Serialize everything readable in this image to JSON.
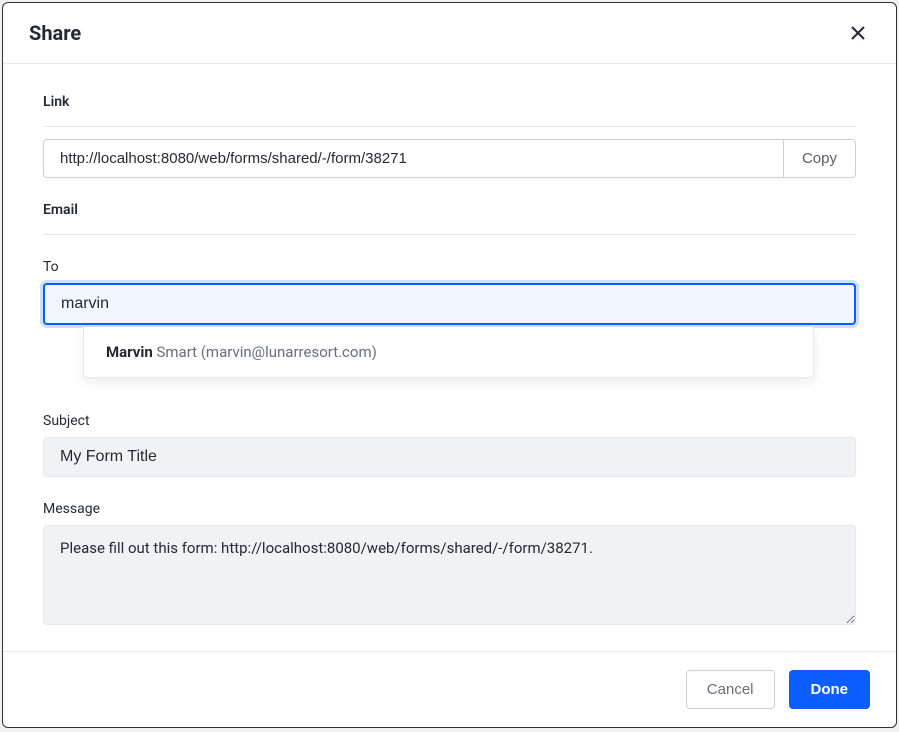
{
  "modal": {
    "title": "Share"
  },
  "link": {
    "section_label": "Link",
    "url": "http://localhost:8080/web/forms/shared/-/form/38271",
    "copy_label": "Copy"
  },
  "email": {
    "section_label": "Email",
    "to_label": "To",
    "to_value": "marvin",
    "autocomplete": {
      "match_prefix": "Marvin",
      "suffix": " Smart (marvin@lunarresort.com)"
    },
    "subject_label": "Subject",
    "subject_value": "My Form Title",
    "message_label": "Message",
    "message_value": "Please fill out this form: http://localhost:8080/web/forms/shared/-/form/38271."
  },
  "footer": {
    "cancel_label": "Cancel",
    "done_label": "Done"
  }
}
